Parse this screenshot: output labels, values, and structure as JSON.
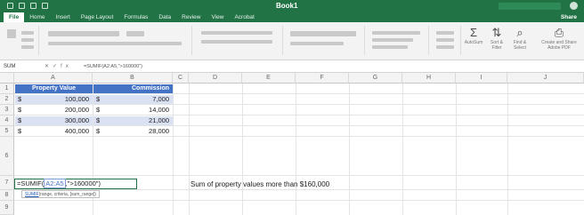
{
  "window": {
    "title": "Book1",
    "accent": "#217346"
  },
  "ribbon_tabs": [
    "File",
    "Home",
    "Insert",
    "Page Layout",
    "Formulas",
    "Data",
    "Review",
    "View",
    "Acrobat"
  ],
  "share_label": "Share",
  "ribbon_buttons": [
    {
      "icon": "sum-icon",
      "glyph": "Σ",
      "label": "AutoSum"
    },
    {
      "icon": "sort-filter-icon",
      "glyph": "⇅",
      "label": "Sort & Filter"
    },
    {
      "icon": "find-select-icon",
      "glyph": "⌕",
      "label": "Find & Select"
    },
    {
      "icon": "create-pdf-icon",
      "glyph": "⎙",
      "label": "Create and Share Adobe PDF"
    }
  ],
  "formula_bar": {
    "name_box": "SUM",
    "content": "=SUMIF(A2:A5,\">160000\")"
  },
  "columns": [
    "A",
    "B",
    "C",
    "D",
    "E",
    "F",
    "G",
    "H",
    "I",
    "J"
  ],
  "rows": [
    "1",
    "2",
    "3",
    "4",
    "5",
    "6",
    "7",
    "8",
    "9"
  ],
  "table": {
    "headers": [
      "Property Value",
      "Commission"
    ],
    "rows": [
      {
        "currency_a": "$",
        "value": "100,000",
        "currency_b": "$",
        "commission": "7,000"
      },
      {
        "currency_a": "$",
        "value": "200,000",
        "currency_b": "$",
        "commission": "14,000"
      },
      {
        "currency_a": "$",
        "value": "300,000",
        "currency_b": "$",
        "commission": "21,000"
      },
      {
        "currency_a": "$",
        "value": "400,000",
        "currency_b": "$",
        "commission": "28,000"
      }
    ]
  },
  "editing_cell": {
    "prefix": "=SUMIF(",
    "range": "A2:A5",
    "suffix": ",\">160000\")"
  },
  "tooltip": {
    "fn": "SUMIF",
    "args": "(range, criteria, [sum_range])"
  },
  "note": "Sum of property values more than $160,000",
  "colors": {
    "header_fill": "#4472c4",
    "band_fill": "#d9e1f2",
    "ribbon_green": "#217346"
  }
}
